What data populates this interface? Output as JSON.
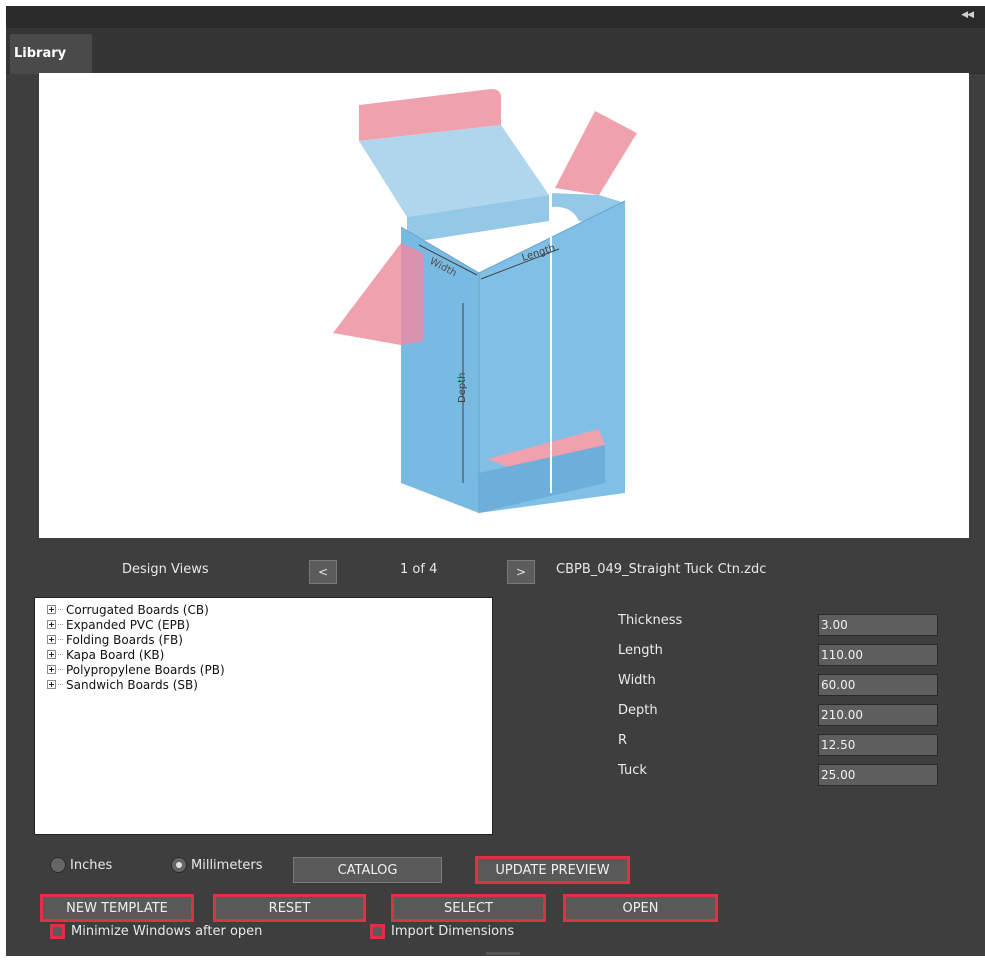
{
  "panel": {
    "tab_label": "Library",
    "collapse_icon": "double-chevron-left-icon"
  },
  "preview": {
    "labels": {
      "width": "Width",
      "length": "Length",
      "depth": "Depth"
    },
    "colors": {
      "body": "#6fb5e0",
      "flap": "#ee9ba8",
      "tuck": "#a9d3ec",
      "outline": "#5e9fc8"
    }
  },
  "nav": {
    "design_views_label": "Design Views",
    "prev_label": "<",
    "page_indicator": "1 of 4",
    "next_label": ">",
    "file_name": "CBPB_049_Straight Tuck Ctn.zdc"
  },
  "tree": {
    "items": [
      "Corrugated Boards (CB)",
      "Expanded PVC (EPB)",
      "Folding Boards (FB)",
      "Kapa Board (KB)",
      "Polypropylene Boards (PB)",
      "Sandwich Boards (SB)"
    ]
  },
  "dimensions": {
    "thickness": {
      "label": "Thickness",
      "value": "3.00"
    },
    "length": {
      "label": "Length",
      "value": "110.00"
    },
    "width": {
      "label": "Width",
      "value": "60.00"
    },
    "depth": {
      "label": "Depth",
      "value": "210.00"
    },
    "r": {
      "label": "R",
      "value": "12.50"
    },
    "tuck": {
      "label": "Tuck",
      "value": "25.00"
    }
  },
  "units": {
    "inches_label": "Inches",
    "millimeters_label": "Millimeters",
    "selected": "Millimeters"
  },
  "buttons": {
    "catalog": "CATALOG",
    "update_preview": "UPDATE PREVIEW",
    "new_template": "NEW TEMPLATE",
    "reset": "RESET",
    "select": "SELECT",
    "open": "OPEN"
  },
  "options": {
    "minimize_label": "Minimize Windows after open",
    "import_label": "Import Dimensions"
  },
  "colors": {
    "highlight": "#e03048",
    "panel_bg": "#3e3e3e"
  }
}
